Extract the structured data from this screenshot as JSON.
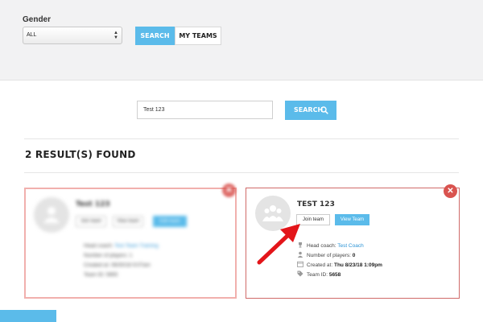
{
  "filters": {
    "gender_label": "Gender",
    "gender_value": "ALL",
    "tabs": [
      "SEARCH",
      "MY TEAMS"
    ]
  },
  "search": {
    "value": "Test 123",
    "button_label": "SEARCH"
  },
  "results_heading": "2 RESULT(S) FOUND",
  "cards": [
    {
      "name": "Test 123",
      "join_label": "Join team",
      "view_label": "View team",
      "extra_label": "Edit team",
      "head_coach_label": "Head coach:",
      "head_coach": "Test Team Training",
      "players_label": "Number of players:",
      "players": "1",
      "created_label": "Created at:",
      "created": "08/30/18 9:07am",
      "team_id_label": "Team ID:",
      "team_id": "5655"
    },
    {
      "name": "TEST 123",
      "join_label": "Join team",
      "view_label": "View Team",
      "head_coach_label": "Head coach:",
      "head_coach": "Test Coach",
      "players_label": "Number of players:",
      "players": "0",
      "created_label": "Created at:",
      "created": "Thu 8/23/18 1:09pm",
      "team_id_label": "Team ID:",
      "team_id": "5658"
    }
  ],
  "icons": {
    "select_arrows": "sort-arrows-icon",
    "search": "magnifier-icon",
    "close": "close-icon",
    "avatar": "team-group-icon",
    "coach": "trophy-icon",
    "players": "user-icon",
    "created": "calendar-icon",
    "team_id": "tag-icon"
  },
  "colors": {
    "accent": "#5bbbea",
    "link": "#2b93d5",
    "danger": "#d9534f",
    "annotation_arrow": "#e3151a"
  }
}
